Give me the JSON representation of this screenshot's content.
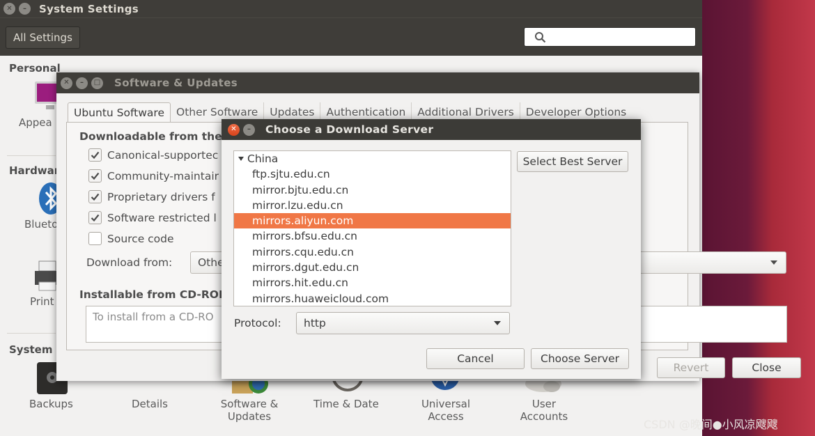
{
  "system_settings": {
    "title": "System Settings",
    "all_settings_label": "All Settings",
    "search_value": "",
    "sections": {
      "personal": "Personal",
      "hardware": "Hardware",
      "system": "System"
    },
    "panels_partial": {
      "appearance": "Appea",
      "bluetooth": "Blueto",
      "printers": "Print"
    },
    "system_panels": [
      {
        "label": "Backups",
        "icon": "backups-icon"
      },
      {
        "label": "Details",
        "icon": "details-icon"
      },
      {
        "label_line1": "Software &",
        "label_line2": "Updates",
        "icon": "software-updates-icon"
      },
      {
        "label": "Time & Date",
        "icon": "clock-icon"
      },
      {
        "label_line1": "Universal",
        "label_line2": "Access",
        "icon": "universal-access-icon"
      },
      {
        "label_line1": "User",
        "label_line2": "Accounts",
        "icon": "user-accounts-icon"
      }
    ]
  },
  "software_updates": {
    "title": "Software & Updates",
    "tabs": [
      "Ubuntu Software",
      "Other Software",
      "Updates",
      "Authentication",
      "Additional Drivers",
      "Developer Options"
    ],
    "active_tab": "Ubuntu Software",
    "downloadable_heading": "Downloadable from the",
    "sources": [
      {
        "label": "Canonical-supportec",
        "checked": true
      },
      {
        "label": "Community-maintair",
        "checked": true
      },
      {
        "label": "Proprietary drivers f",
        "checked": true
      },
      {
        "label": "Software restricted l",
        "checked": true
      },
      {
        "label": "Source code",
        "checked": false
      }
    ],
    "download_from_label": "Download from:",
    "download_from_value": "Othe",
    "cdrom_heading": "Installable from CD-RON",
    "cdrom_placeholder": "To install from a CD-RO",
    "revert_label": "Revert",
    "close_label": "Close"
  },
  "download_server_dialog": {
    "title": "Choose a Download Server",
    "group": "China",
    "mirrors": [
      "ftp.sjtu.edu.cn",
      "mirror.bjtu.edu.cn",
      "mirror.lzu.edu.cn",
      "mirrors.aliyun.com",
      "mirrors.bfsu.edu.cn",
      "mirrors.cqu.edu.cn",
      "mirrors.dgut.edu.cn",
      "mirrors.hit.edu.cn",
      "mirrors.huaweicloud.com"
    ],
    "selected_mirror": "mirrors.aliyun.com",
    "select_best_label": "Select Best Server",
    "protocol_label": "Protocol:",
    "protocol_value": "http",
    "cancel_label": "Cancel",
    "choose_label": "Choose Server"
  },
  "watermark": "CSDN @晚间●小风凉飕飕",
  "colors": {
    "selection": "#f07746",
    "titlebar": "#3f3d39",
    "close_button": "#e5572b"
  }
}
